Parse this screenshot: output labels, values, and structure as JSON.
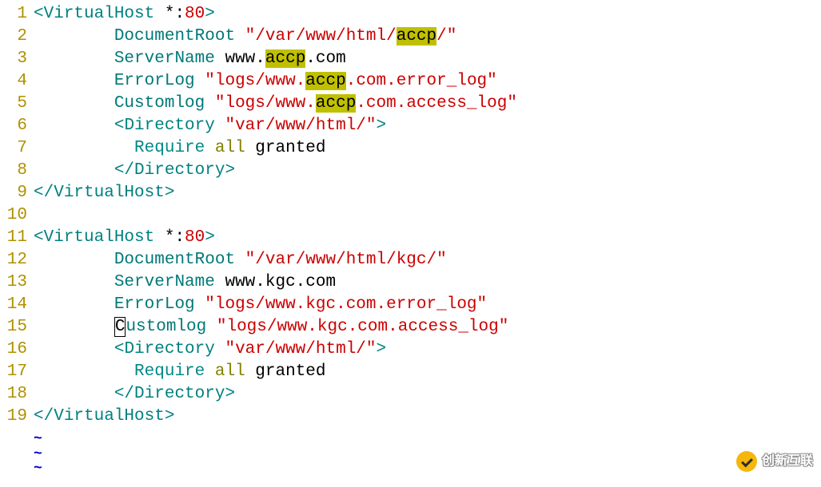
{
  "lineNumbers": [
    "1",
    "2",
    "3",
    "4",
    "5",
    "6",
    "7",
    "8",
    "9",
    "10",
    "11",
    "12",
    "13",
    "14",
    "15",
    "16",
    "17",
    "18",
    "19"
  ],
  "watermark": "创新互联",
  "tildeCount": 3,
  "highlight": "accp",
  "lines": {
    "l1": {
      "open": "<",
      "tag": "VirtualHost",
      "sep": " *:",
      "port": "80",
      "close": ">"
    },
    "l2": {
      "indent": "\t",
      "key": "DocumentRoot",
      "sp": " ",
      "q1": "\"",
      "p1": "/var/www/html/",
      "hl": "accp",
      "p2": "/",
      "q2": "\""
    },
    "l3": {
      "indent": "\t",
      "key": "ServerName",
      "sp": " ",
      "d1": "www.",
      "hl": "accp",
      "d2": ".com"
    },
    "l4": {
      "indent": "\t",
      "key": "ErrorLog",
      "sp": " ",
      "q1": "\"",
      "p1": "logs/www.",
      "hl": "accp",
      "p2": ".com.error_log",
      "q2": "\""
    },
    "l5": {
      "indent": "\t",
      "key": "Customlog",
      "sp": " ",
      "q1": "\"",
      "p1": "logs/www.",
      "hl": "accp",
      "p2": ".com.access_log",
      "q2": "\""
    },
    "l6": {
      "indent": "\t",
      "open": "<",
      "tag": "Directory",
      "sp": " ",
      "val": "\"var/www/html/\"",
      "close": ">"
    },
    "l7": {
      "indent": "\t  ",
      "kw1": "Require",
      "sp1": " ",
      "kw2": "all",
      "sp2": " ",
      "text": "granted"
    },
    "l8": {
      "indent": "\t",
      "open": "</",
      "tag": "Directory",
      "close": ">"
    },
    "l9": {
      "open": "</",
      "tag": "VirtualHost",
      "close": ">"
    },
    "l11": {
      "open": "<",
      "tag": "VirtualHost",
      "sep": " *:",
      "port": "80",
      "close": ">"
    },
    "l12": {
      "indent": "\t",
      "key": "DocumentRoot",
      "sp": " ",
      "val": "\"/var/www/html/kgc/\""
    },
    "l13": {
      "indent": "\t",
      "key": "ServerName",
      "sp": " ",
      "val": "www.kgc.com"
    },
    "l14": {
      "indent": "\t",
      "key": "ErrorLog",
      "sp": " ",
      "val": "\"logs/www.kgc.com.error_log\""
    },
    "l15": {
      "indent": "\t",
      "cursor": "C",
      "key": "ustomlog",
      "sp": " ",
      "val": "\"logs/www.kgc.com.access_log\""
    },
    "l16": {
      "indent": "\t",
      "open": "<",
      "tag": "Directory",
      "sp": " ",
      "val": "\"var/www/html/\"",
      "close": ">"
    },
    "l17": {
      "indent": "\t  ",
      "kw1": "Require",
      "sp1": " ",
      "kw2": "all",
      "sp2": " ",
      "text": "granted"
    },
    "l18": {
      "indent": "\t",
      "open": "</",
      "tag": "Directory",
      "close": ">"
    },
    "l19": {
      "open": "</",
      "tag": "VirtualHost",
      "close": ">"
    }
  }
}
